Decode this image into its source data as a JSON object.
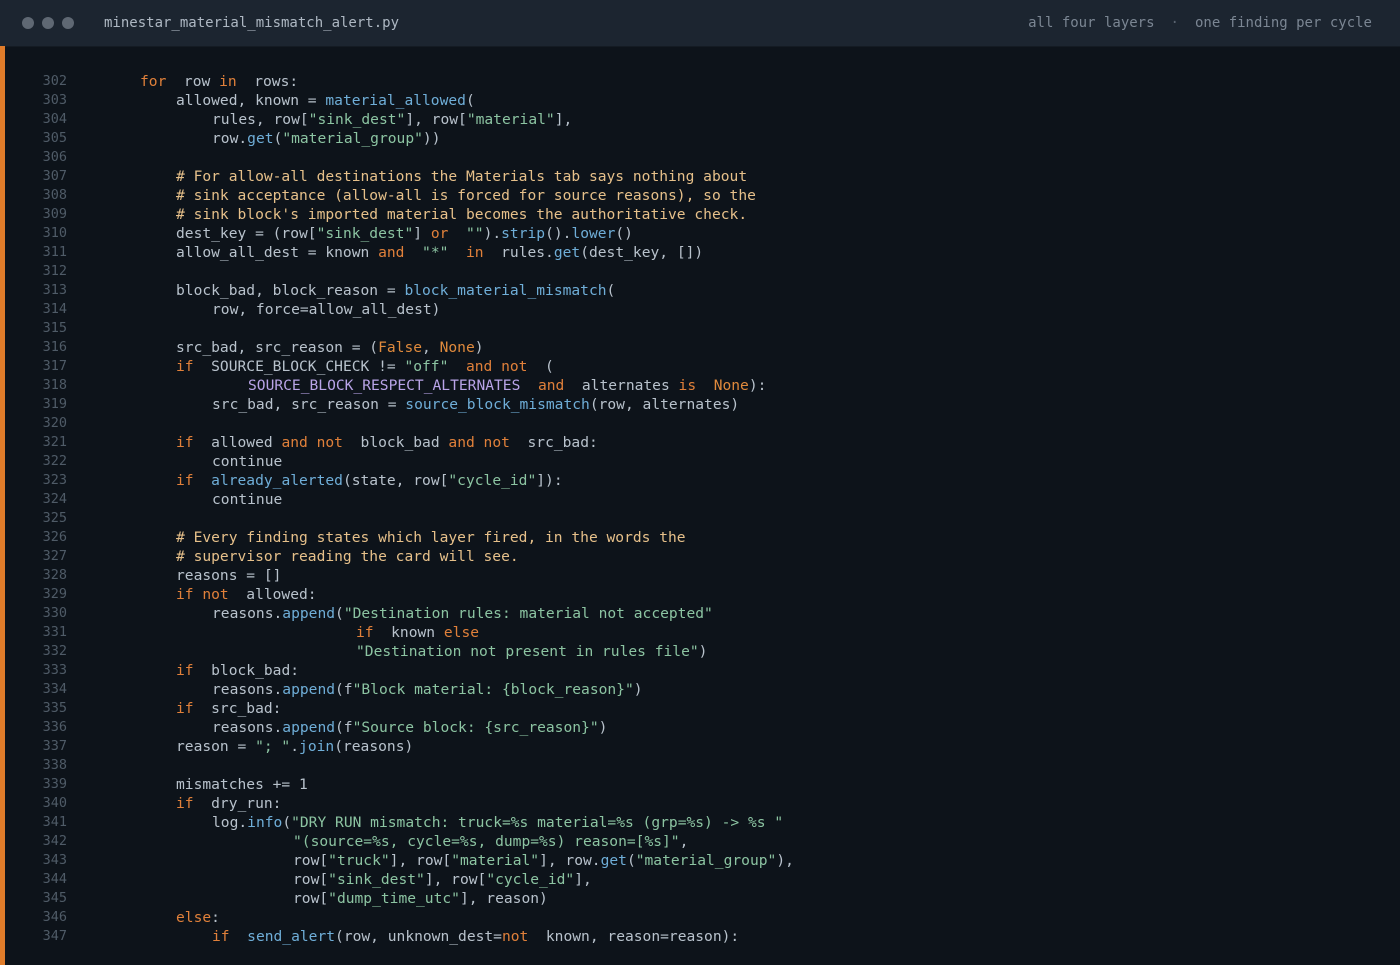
{
  "titlebar": {
    "filename": "minestar_material_mismatch_alert.py",
    "meta_left": "all four layers",
    "meta_sep": "·",
    "meta_right": "one finding per cycle"
  },
  "colors": {
    "accent": "#e07c2a",
    "keyword": "#e0803a",
    "function": "#6faed8",
    "string": "#8cc4a2",
    "comment": "#e6c08a",
    "background": "#0d131a"
  },
  "code": {
    "lines": [
      {
        "n": "302",
        "indent": 0,
        "tokens": [
          [
            "kw",
            "for"
          ],
          [
            "",
            "  row "
          ],
          [
            "kw",
            "in"
          ],
          [
            "",
            "  rows:"
          ]
        ]
      },
      {
        "n": "303",
        "indent": 1,
        "tokens": [
          [
            "",
            "allowed, known = "
          ],
          [
            "fn",
            "material_allowed"
          ],
          [
            "",
            "("
          ]
        ]
      },
      {
        "n": "304",
        "indent": 2,
        "tokens": [
          [
            "",
            "rules, row["
          ],
          [
            "str",
            "\"sink_dest\""
          ],
          [
            "",
            "], row["
          ],
          [
            "str",
            "\"material\""
          ],
          [
            "",
            "],"
          ]
        ]
      },
      {
        "n": "305",
        "indent": 2,
        "tokens": [
          [
            "",
            "row."
          ],
          [
            "fn",
            "get"
          ],
          [
            "",
            "("
          ],
          [
            "str",
            "\"material_group\""
          ],
          [
            "",
            "))"
          ]
        ]
      },
      {
        "n": "306",
        "indent": 0,
        "tokens": []
      },
      {
        "n": "307",
        "indent": 1,
        "tokens": [
          [
            "com",
            "# For allow-all destinations the Materials tab says nothing about"
          ]
        ]
      },
      {
        "n": "308",
        "indent": 1,
        "tokens": [
          [
            "com",
            "# sink acceptance (allow-all is forced for source reasons), so the"
          ]
        ]
      },
      {
        "n": "309",
        "indent": 1,
        "tokens": [
          [
            "com",
            "# sink block's imported material becomes the authoritative check."
          ]
        ]
      },
      {
        "n": "310",
        "indent": 1,
        "tokens": [
          [
            "",
            "dest_key = (row["
          ],
          [
            "str",
            "\"sink_dest\""
          ],
          [
            "",
            "] "
          ],
          [
            "kw",
            "or"
          ],
          [
            "",
            "  "
          ],
          [
            "str",
            "\"\""
          ],
          [
            "",
            ")."
          ],
          [
            "fn",
            "strip"
          ],
          [
            "",
            "()."
          ],
          [
            "fn",
            "lower"
          ],
          [
            "",
            "()"
          ]
        ]
      },
      {
        "n": "311",
        "indent": 1,
        "tokens": [
          [
            "",
            "allow_all_dest = known "
          ],
          [
            "kw",
            "and"
          ],
          [
            "",
            "  "
          ],
          [
            "str",
            "\"*\""
          ],
          [
            "",
            "  "
          ],
          [
            "kw",
            "in"
          ],
          [
            "",
            "  rules."
          ],
          [
            "fn",
            "get"
          ],
          [
            "",
            "(dest_key, [])"
          ]
        ]
      },
      {
        "n": "312",
        "indent": 0,
        "tokens": []
      },
      {
        "n": "313",
        "indent": 1,
        "tokens": [
          [
            "",
            "block_bad, block_reason = "
          ],
          [
            "fn",
            "block_material_mismatch"
          ],
          [
            "",
            "("
          ]
        ]
      },
      {
        "n": "314",
        "indent": 2,
        "tokens": [
          [
            "",
            "row, force=allow_all_dest)"
          ]
        ]
      },
      {
        "n": "315",
        "indent": 0,
        "tokens": []
      },
      {
        "n": "316",
        "indent": 1,
        "tokens": [
          [
            "",
            "src_bad, src_reason = ("
          ],
          [
            "const",
            "False"
          ],
          [
            "",
            ", "
          ],
          [
            "const",
            "None"
          ],
          [
            "",
            ")"
          ]
        ]
      },
      {
        "n": "317",
        "indent": 1,
        "tokens": [
          [
            "kw",
            "if"
          ],
          [
            "",
            "  SOURCE_BLOCK_CHECK != "
          ],
          [
            "str",
            "\"off\""
          ],
          [
            "",
            "  "
          ],
          [
            "kw",
            "and not"
          ],
          [
            "",
            "  ("
          ]
        ]
      },
      {
        "n": "318",
        "indent": 3,
        "tokens": [
          [
            "cls",
            "SOURCE_BLOCK_RESPECT_ALTERNATES"
          ],
          [
            "",
            "  "
          ],
          [
            "kw",
            "and"
          ],
          [
            "",
            "  alternates "
          ],
          [
            "kw",
            "is"
          ],
          [
            "",
            "  "
          ],
          [
            "const",
            "None"
          ],
          [
            "",
            "):"
          ]
        ]
      },
      {
        "n": "319",
        "indent": 2,
        "tokens": [
          [
            "",
            "src_bad, src_reason = "
          ],
          [
            "fn",
            "source_block_mismatch"
          ],
          [
            "",
            "(row, alternates)"
          ]
        ]
      },
      {
        "n": "320",
        "indent": 0,
        "tokens": []
      },
      {
        "n": "321",
        "indent": 1,
        "tokens": [
          [
            "kw",
            "if"
          ],
          [
            "",
            "  allowed "
          ],
          [
            "kw",
            "and not"
          ],
          [
            "",
            "  block_bad "
          ],
          [
            "kw",
            "and not"
          ],
          [
            "",
            "  src_bad:"
          ]
        ]
      },
      {
        "n": "322",
        "indent": 2,
        "tokens": [
          [
            "",
            "continue"
          ]
        ]
      },
      {
        "n": "323",
        "indent": 1,
        "tokens": [
          [
            "kw",
            "if"
          ],
          [
            "",
            "  "
          ],
          [
            "fn",
            "already_alerted"
          ],
          [
            "",
            "(state, row["
          ],
          [
            "str",
            "\"cycle_id\""
          ],
          [
            "",
            "]):"
          ]
        ]
      },
      {
        "n": "324",
        "indent": 2,
        "tokens": [
          [
            "",
            "continue"
          ]
        ]
      },
      {
        "n": "325",
        "indent": 0,
        "tokens": []
      },
      {
        "n": "326",
        "indent": 1,
        "tokens": [
          [
            "com",
            "# Every finding states which layer fired, in the words the"
          ]
        ]
      },
      {
        "n": "327",
        "indent": 1,
        "tokens": [
          [
            "com",
            "# supervisor reading the card will see."
          ]
        ]
      },
      {
        "n": "328",
        "indent": 1,
        "tokens": [
          [
            "",
            "reasons = []"
          ]
        ]
      },
      {
        "n": "329",
        "indent": 1,
        "tokens": [
          [
            "kw",
            "if not"
          ],
          [
            "",
            "  allowed:"
          ]
        ]
      },
      {
        "n": "330",
        "indent": 2,
        "tokens": [
          [
            "",
            "reasons."
          ],
          [
            "fn",
            "append"
          ],
          [
            "",
            "("
          ],
          [
            "str",
            "\"Destination rules: material not accepted\""
          ]
        ]
      },
      {
        "n": "331",
        "indent": 6,
        "tokens": [
          [
            "kw",
            "if"
          ],
          [
            "",
            "  known "
          ],
          [
            "kw",
            "else"
          ]
        ]
      },
      {
        "n": "332",
        "indent": 6,
        "tokens": [
          [
            "str",
            "\"Destination not present in rules file\""
          ],
          [
            "",
            ")"
          ]
        ]
      },
      {
        "n": "333",
        "indent": 1,
        "tokens": [
          [
            "kw",
            "if"
          ],
          [
            "",
            "  block_bad:"
          ]
        ]
      },
      {
        "n": "334",
        "indent": 2,
        "tokens": [
          [
            "",
            "reasons."
          ],
          [
            "fn",
            "append"
          ],
          [
            "",
            "(f"
          ],
          [
            "str",
            "\"Block material: {block_reason}\""
          ],
          [
            "",
            ")"
          ]
        ]
      },
      {
        "n": "335",
        "indent": 1,
        "tokens": [
          [
            "kw",
            "if"
          ],
          [
            "",
            "  src_bad:"
          ]
        ]
      },
      {
        "n": "336",
        "indent": 2,
        "tokens": [
          [
            "",
            "reasons."
          ],
          [
            "fn",
            "append"
          ],
          [
            "",
            "(f"
          ],
          [
            "str",
            "\"Source block: {src_reason}\""
          ],
          [
            "",
            ")"
          ]
        ]
      },
      {
        "n": "337",
        "indent": 1,
        "tokens": [
          [
            "",
            "reason = "
          ],
          [
            "str",
            "\"; \""
          ],
          [
            "",
            "."
          ],
          [
            "fn",
            "join"
          ],
          [
            "",
            "(reasons)"
          ]
        ]
      },
      {
        "n": "338",
        "indent": 0,
        "tokens": []
      },
      {
        "n": "339",
        "indent": 1,
        "tokens": [
          [
            "",
            "mismatches += 1"
          ]
        ]
      },
      {
        "n": "340",
        "indent": 1,
        "tokens": [
          [
            "kw",
            "if"
          ],
          [
            "",
            "  dry_run:"
          ]
        ]
      },
      {
        "n": "341",
        "indent": 2,
        "tokens": [
          [
            "",
            "log."
          ],
          [
            "fn",
            "info"
          ],
          [
            "",
            "("
          ],
          [
            "str",
            "\"DRY RUN mismatch: truck=%s material=%s (grp=%s) -> %s \""
          ]
        ]
      },
      {
        "n": "342",
        "indent": 4.25,
        "tokens": [
          [
            "str",
            "\"(source=%s, cycle=%s, dump=%s) reason=[%s]\""
          ],
          [
            "",
            ","
          ]
        ]
      },
      {
        "n": "343",
        "indent": 4.25,
        "tokens": [
          [
            "",
            "row["
          ],
          [
            "str",
            "\"truck\""
          ],
          [
            "",
            "], row["
          ],
          [
            "str",
            "\"material\""
          ],
          [
            "",
            "], row."
          ],
          [
            "fn",
            "get"
          ],
          [
            "",
            "("
          ],
          [
            "str",
            "\"material_group\""
          ],
          [
            "",
            "),"
          ]
        ]
      },
      {
        "n": "344",
        "indent": 4.25,
        "tokens": [
          [
            "",
            "row["
          ],
          [
            "str",
            "\"sink_dest\""
          ],
          [
            "",
            "], row["
          ],
          [
            "str",
            "\"cycle_id\""
          ],
          [
            "",
            "],"
          ]
        ]
      },
      {
        "n": "345",
        "indent": 4.25,
        "tokens": [
          [
            "",
            "row["
          ],
          [
            "str",
            "\"dump_time_utc\""
          ],
          [
            "",
            "], reason)"
          ]
        ]
      },
      {
        "n": "346",
        "indent": 1,
        "tokens": [
          [
            "kw",
            "else"
          ],
          [
            "",
            ":"
          ]
        ]
      },
      {
        "n": "347",
        "indent": 2,
        "tokens": [
          [
            "kw",
            "if"
          ],
          [
            "",
            "  "
          ],
          [
            "fn",
            "send_alert"
          ],
          [
            "",
            "(row, unknown_dest="
          ],
          [
            "kw",
            "not"
          ],
          [
            "",
            "  known, reason=reason):"
          ]
        ]
      }
    ]
  }
}
